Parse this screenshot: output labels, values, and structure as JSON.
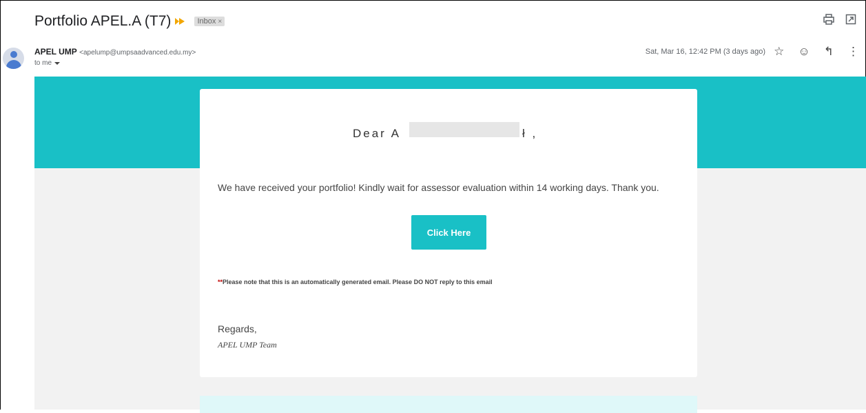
{
  "header": {
    "subject": "Portfolio APEL.A (T7)",
    "label": "Inbox",
    "label_remove": "×"
  },
  "message": {
    "sender_name": "APEL UMP",
    "sender_email": "<apelump@umpsaadvanced.edu.my>",
    "to": "to me",
    "date": "Sat, Mar 16, 12:42 PM (3 days ago)"
  },
  "email": {
    "greeting_start": "Dear A",
    "greeting_end": "ł ,",
    "body": "We have received your portfolio! Kindly wait for assessor evaluation within 14 working days. Thank you.",
    "button_label": "Click Here",
    "note_prefix": "**",
    "note": "Please note that this is an automatically generated email. Please DO NOT reply to this email",
    "regards": "Regards,",
    "signature": "APEL UMP Team"
  },
  "icons": {
    "print": "print-icon",
    "popout": "open-in-new-window-icon",
    "star": "star-icon",
    "emoji": "emoji-icon",
    "reply": "reply-icon",
    "more": "more-vert-icon"
  },
  "colors": {
    "accent": "#19c0c6",
    "importance": "#f2a600",
    "note_star": "#c00000"
  }
}
